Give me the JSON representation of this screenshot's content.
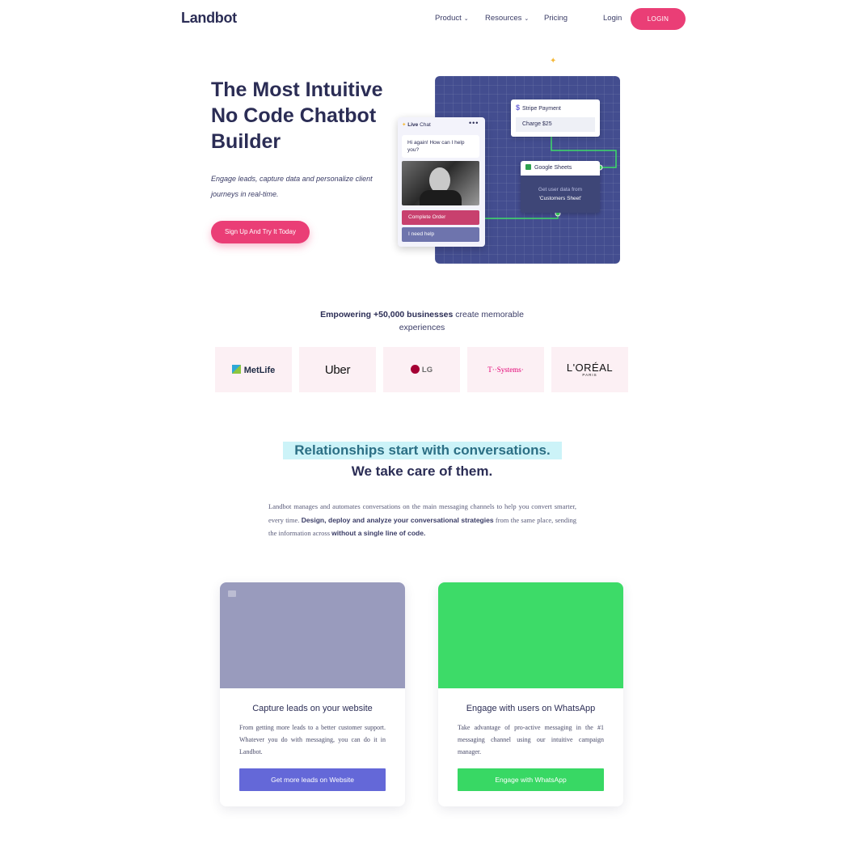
{
  "nav": {
    "logo": "Landbot",
    "items": [
      {
        "label": "Product",
        "has_dropdown": true
      },
      {
        "label": "Resources",
        "has_dropdown": true
      },
      {
        "label": "Pricing",
        "has_dropdown": false
      }
    ],
    "login_link": "Login",
    "login_button": "LOGIN",
    "chevron_glyph": "⌄"
  },
  "hero": {
    "title": "The Most Intuitive No Code Chatbot Builder",
    "subtitle": "Engage leads, capture data and personalize client journeys in real-time.",
    "cta": "Sign Up And Try It Today",
    "illustration": {
      "stripe_card": {
        "title": "Stripe Payment",
        "icon": "$",
        "field": "Charge $25"
      },
      "sheets_card": {
        "title": "Google Sheets",
        "line1": "Get user data from",
        "line2": "'Customers Sheet'"
      },
      "chat": {
        "header_bold": "Live",
        "header_text": "Chat",
        "menu": "•••",
        "bubble": "Hi again! How can I help you?",
        "option_1": "Complete Order",
        "option_2": "I need help"
      }
    }
  },
  "empower": {
    "bold": "Empowering +50,000 businesses",
    "rest": " create memorable experiences",
    "logos": [
      {
        "name": "MetLife"
      },
      {
        "name": "Uber"
      },
      {
        "name": "LG"
      },
      {
        "name": "T··Systems·"
      },
      {
        "name": "L'ORÉAL",
        "sub": "PARIS"
      }
    ]
  },
  "relationships": {
    "title": "Relationships start with conversations.",
    "subtitle": "We take care of them.",
    "body_1": "Landbot manages and automates conversations on the main messaging channels to help you convert smarter, every time. ",
    "body_2": "Design, deploy and analyze your conversational strategies",
    "body_3": " from the same place, sending the information across ",
    "body_4": "without a single line of code."
  },
  "features": [
    {
      "title": "Capture leads on your website",
      "desc": "From getting more leads to a better customer support. Whatever you do with messaging, you can do it in Landbot.",
      "button": "Get more leads on Website",
      "media_color": "#999bbd",
      "button_color": "#6468d8"
    },
    {
      "title": "Engage with users on WhatsApp",
      "desc": "Take advantage of pro-active messaging in the #1 messaging channel using our intuitive campaign manager.",
      "button": "Engage with WhatsApp",
      "media_color": "#3ddb68",
      "button_color": "#38d864"
    }
  ],
  "colors": {
    "brand_pink": "#ea3e76",
    "navy": "#2b2d55",
    "panel": "#434d8f",
    "highlight": "#ccf3f8"
  }
}
